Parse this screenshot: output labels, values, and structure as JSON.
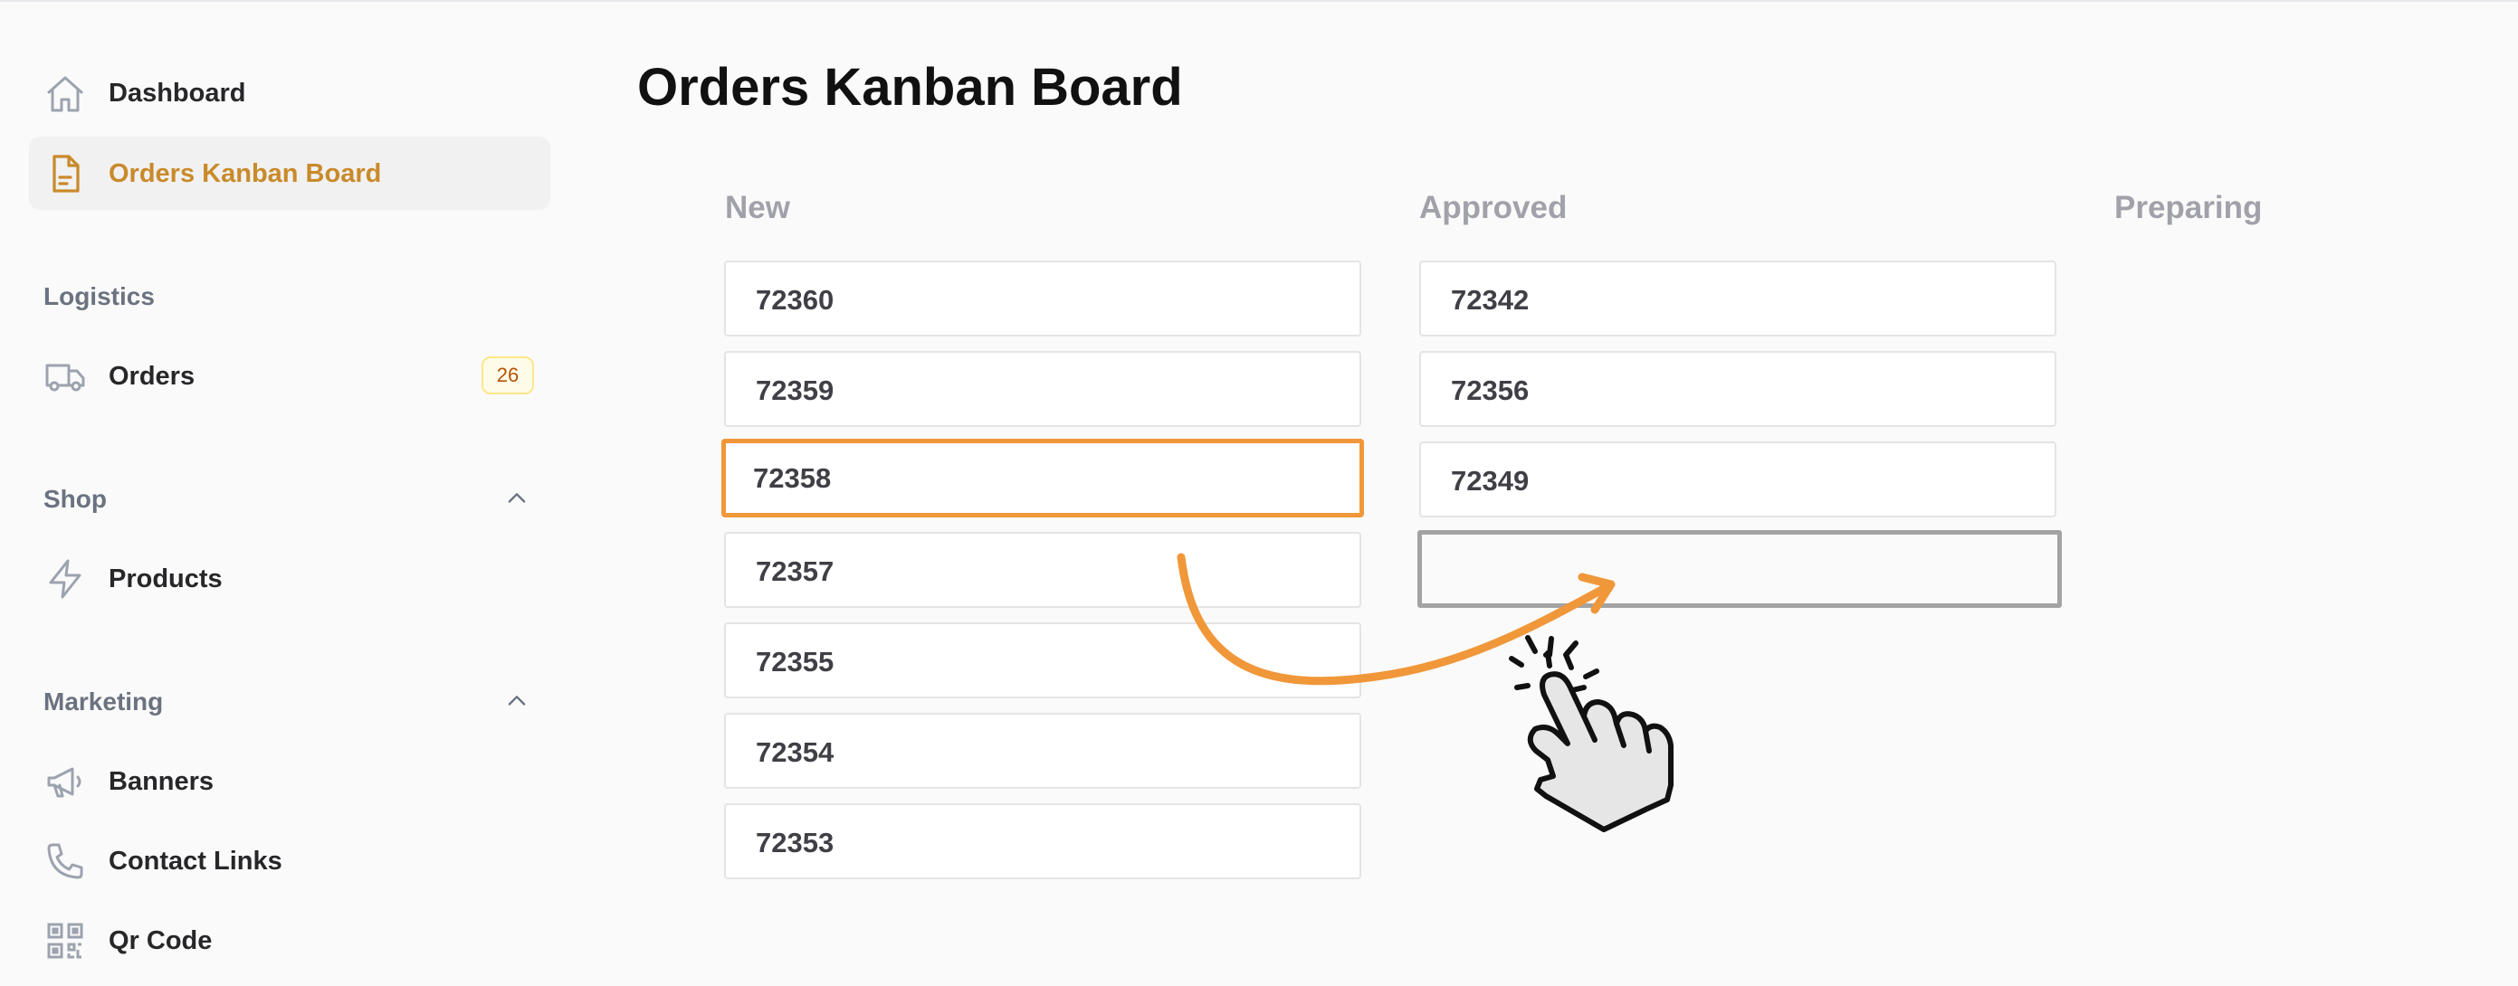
{
  "sidebar": {
    "items": [
      {
        "label": "Dashboard",
        "icon": "home-icon"
      },
      {
        "label": "Orders Kanban Board",
        "icon": "document-icon",
        "active": true,
        "active_color": "#c98a2b"
      }
    ],
    "sections": [
      {
        "title": "Logistics",
        "items": [
          {
            "label": "Orders",
            "icon": "truck-icon",
            "badge": "26"
          }
        ]
      },
      {
        "title": "Shop",
        "collapsible": true,
        "items": [
          {
            "label": "Products",
            "icon": "lightning-icon"
          }
        ]
      },
      {
        "title": "Marketing",
        "collapsible": true,
        "items": [
          {
            "label": "Banners",
            "icon": "megaphone-icon"
          },
          {
            "label": "Contact Links",
            "icon": "phone-icon"
          },
          {
            "label": "Qr Code",
            "icon": "qr-code-icon"
          }
        ]
      }
    ]
  },
  "page": {
    "title": "Orders Kanban Board"
  },
  "board": {
    "columns": [
      {
        "title": "New",
        "cards": [
          "72360",
          "72359",
          "72358",
          "72357",
          "72355",
          "72354",
          "72353"
        ],
        "selected_card": "72358"
      },
      {
        "title": "Approved",
        "cards": [
          "72342",
          "72356",
          "72349"
        ],
        "drop_placeholder": true
      },
      {
        "title": "Preparing",
        "cards": []
      }
    ]
  },
  "colors": {
    "accent": "#f0973a",
    "active_text": "#c98a2b",
    "placeholder_border": "#a3a3a3"
  },
  "overlay": {
    "icons": [
      "drag-arrow-icon",
      "hand-pointer-icon"
    ]
  }
}
